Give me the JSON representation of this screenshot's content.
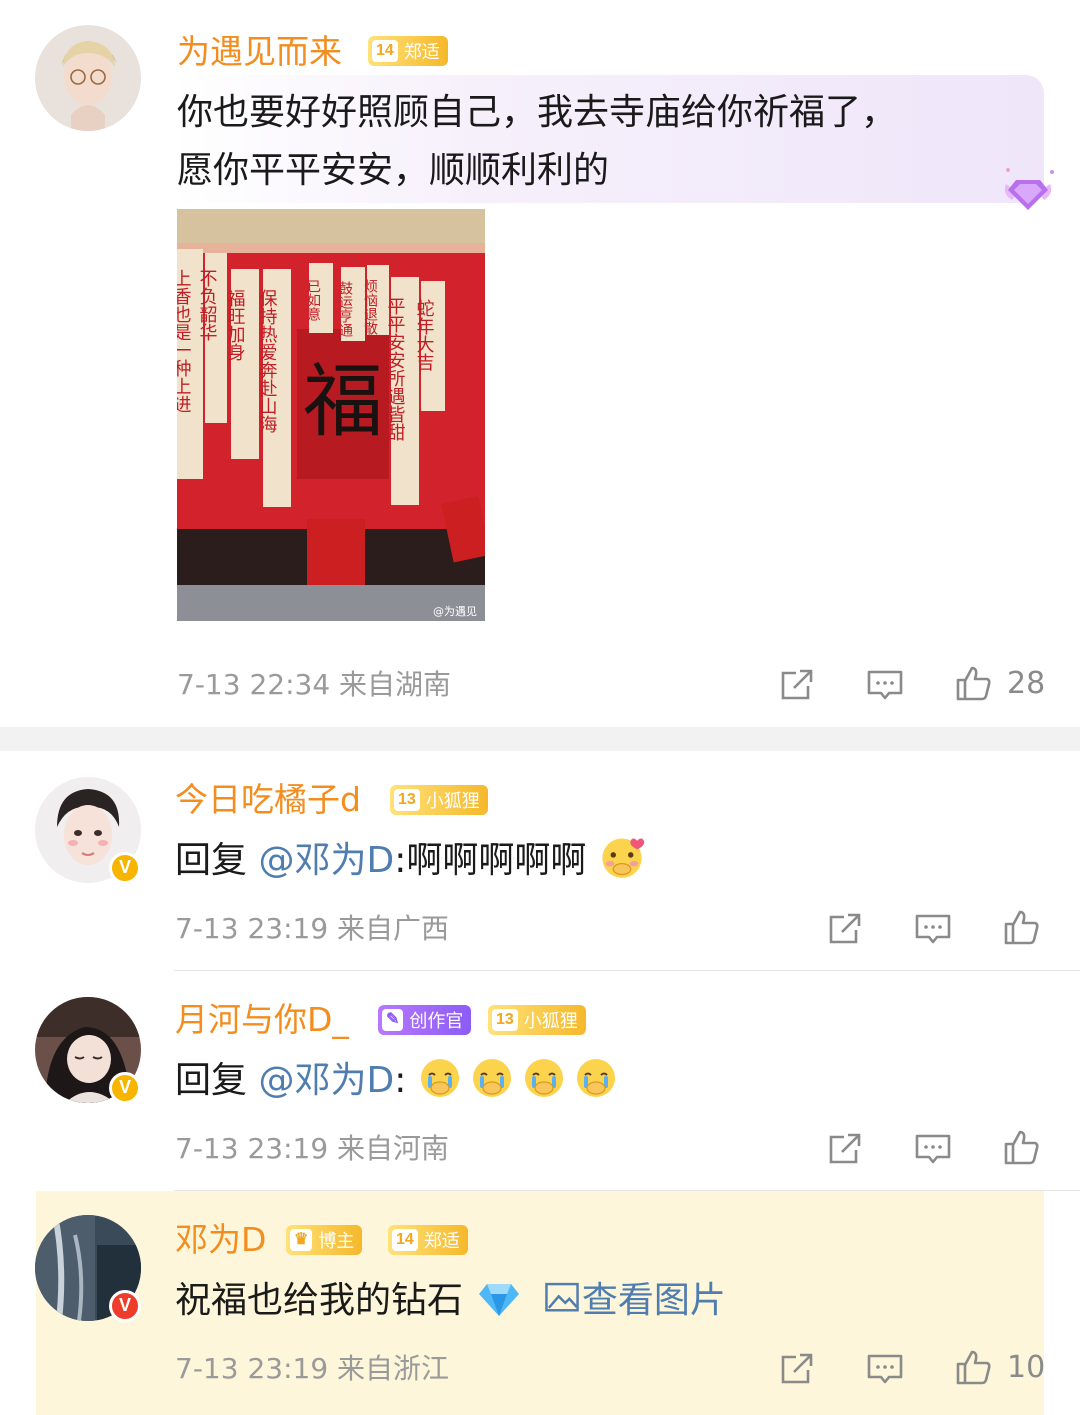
{
  "comments": [
    {
      "username": "为遇见而来",
      "badges": [
        {
          "level": "14",
          "label": "郑适",
          "style": "gold"
        }
      ],
      "text": "你也要好好照顾自己，我去寺庙给你祈福了，",
      "text2": "愿你平平安安，顺顺利利的",
      "meta": "7-13 22:34  来自湖南",
      "likes": "28",
      "verified": false
    },
    {
      "username": "今日吃橘子d",
      "badges": [
        {
          "level": "13",
          "label": "小狐狸",
          "style": "gold"
        }
      ],
      "reply_prefix": "回复 ",
      "mention": "@邓为D",
      "text_after": ":啊啊啊啊啊",
      "meta": "7-13 23:19  来自广西",
      "verified": true
    },
    {
      "username": "月河与你D_",
      "badges": [
        {
          "label": "创作官",
          "style": "purple"
        },
        {
          "level": "13",
          "label": "小狐狸",
          "style": "gold"
        }
      ],
      "reply_prefix": "回复 ",
      "mention": "@邓为D",
      "text_after": ":",
      "meta": "7-13 23:19  来自河南",
      "verified": true
    },
    {
      "username": "邓为D",
      "badges": [
        {
          "label": "博主",
          "style": "gold"
        },
        {
          "level": "14",
          "label": "郑适",
          "style": "gold"
        }
      ],
      "text": "祝福也给我的钻石",
      "view_image": "查看图片",
      "meta": "7-13 23:19  来自浙江",
      "likes": "10",
      "verified": true
    }
  ],
  "photo": {
    "center_char": "福",
    "scrolls": [
      "保持热爱奔赴山海",
      "平平安安所遇皆甜",
      "蛇年大吉",
      "福旺加身",
      "上香也是一种上进",
      "不负韶华",
      "已如意",
      "鼓运亨通",
      "烦恼退散"
    ],
    "watermark": "@为遇见"
  },
  "colors": {
    "username": "#f28d1e",
    "mention": "#507daf",
    "highlight_bg": "#fdf6da",
    "meta": "#9a9a9a"
  },
  "icons": [
    "share-icon",
    "comment-icon",
    "like-icon",
    "diamond-emoji",
    "cry-emoji",
    "image-icon",
    "verified-icon"
  ]
}
